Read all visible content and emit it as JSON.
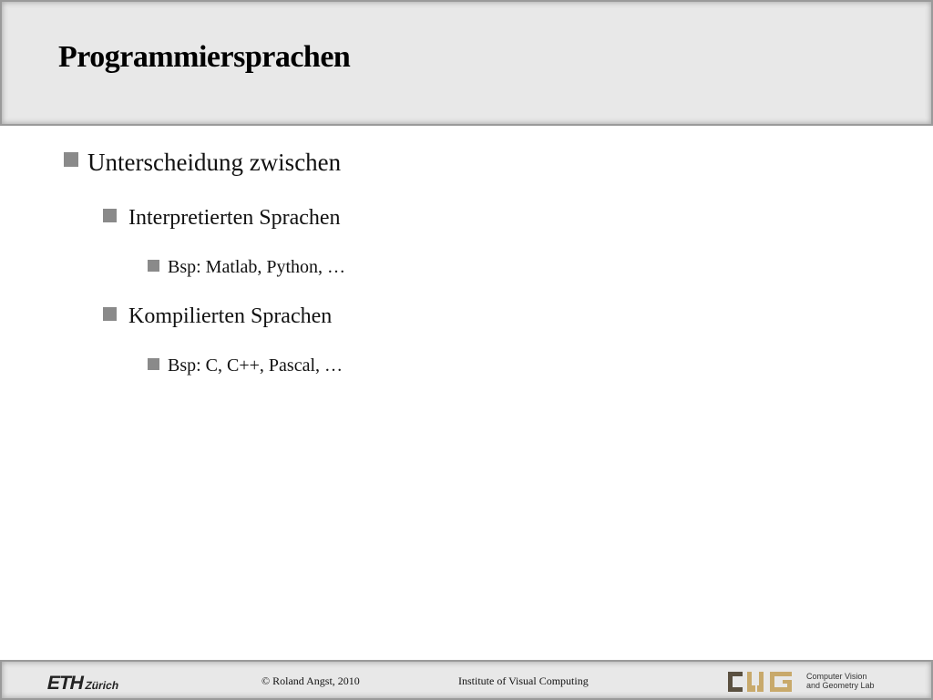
{
  "slide": {
    "title": "Programmiersprachen"
  },
  "content": {
    "items": [
      {
        "level": 1,
        "text": "Unterscheidung zwischen"
      },
      {
        "level": 2,
        "text": "Interpretierten Sprachen"
      },
      {
        "level": 3,
        "text": "Bsp: Matlab, Python, …"
      },
      {
        "level": 2,
        "text": "Kompilierten Sprachen"
      },
      {
        "level": 3,
        "text": "Bsp: C, C++, Pascal, …"
      }
    ]
  },
  "footer": {
    "eth_logo": "ETH",
    "eth_logo_sub": "Zürich",
    "copyright": "© Roland Angst, 2010",
    "institute": "Institute of Visual Computing",
    "cvg_logo_text": "CVG",
    "lab_name_line1": "Computer Vision",
    "lab_name_line2": "and Geometry Lab"
  },
  "colors": {
    "header_bg": "#e8e8e8",
    "bullet": "#8a8a8a",
    "cvg_logo_dark": "#5a5040",
    "cvg_logo_gold": "#c8a96b"
  }
}
